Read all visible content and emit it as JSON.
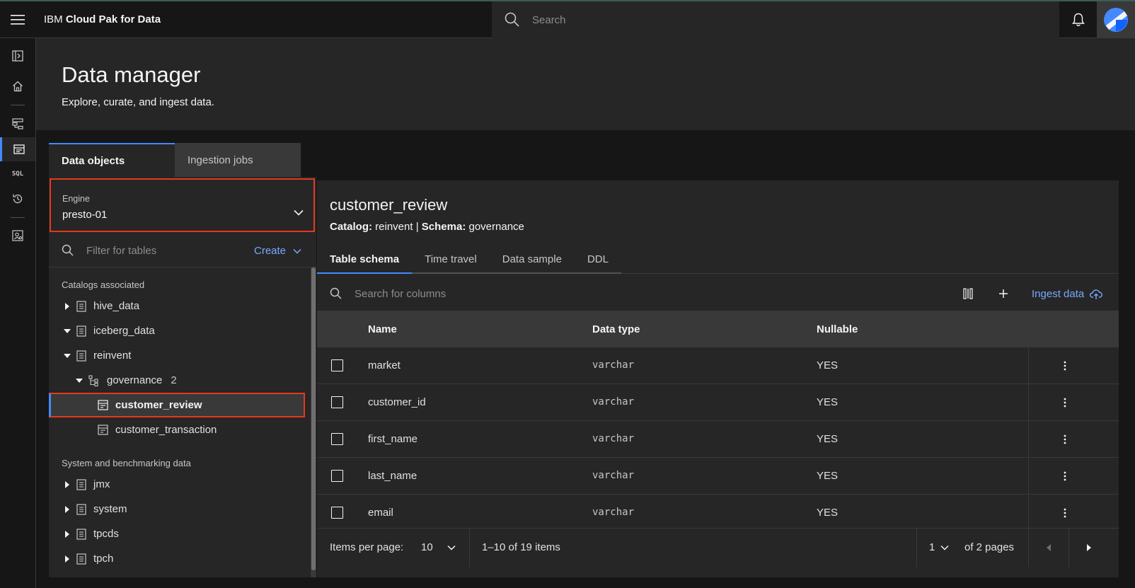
{
  "topbar": {
    "brand_prefix": "IBM",
    "brand_name": "Cloud Pak for Data",
    "search_placeholder": "Search"
  },
  "header": {
    "title": "Data manager",
    "subtitle": "Explore, curate, and ingest data."
  },
  "main_tabs": [
    {
      "label": "Data objects",
      "active": true
    },
    {
      "label": "Ingestion jobs",
      "active": false
    }
  ],
  "left_nav": {
    "sql_label": "SQL"
  },
  "engine": {
    "label": "Engine",
    "value": "presto-01"
  },
  "filter": {
    "placeholder": "Filter for tables",
    "create_label": "Create"
  },
  "tree": {
    "section1": "Catalogs associated",
    "catalogs": [
      {
        "name": "hive_data"
      },
      {
        "name": "iceberg_data"
      },
      {
        "name": "reinvent"
      }
    ],
    "schema": {
      "name": "governance",
      "count": "2"
    },
    "tables": [
      {
        "name": "customer_review"
      },
      {
        "name": "customer_transaction"
      }
    ],
    "section2": "System and benchmarking data",
    "system": [
      {
        "name": "jmx"
      },
      {
        "name": "system"
      },
      {
        "name": "tpcds"
      },
      {
        "name": "tpch"
      }
    ]
  },
  "detail": {
    "title": "customer_review",
    "catalog_label": "Catalog:",
    "catalog_value": "reinvent",
    "separator": "|",
    "schema_label": "Schema:",
    "schema_value": "governance",
    "tabs": [
      {
        "label": "Table schema",
        "active": true
      },
      {
        "label": "Time travel",
        "active": false
      },
      {
        "label": "Data sample",
        "active": false
      },
      {
        "label": "DDL",
        "active": false
      }
    ],
    "column_search_placeholder": "Search for columns",
    "ingest_label": "Ingest data",
    "columns": {
      "name": "Name",
      "type": "Data type",
      "nullable": "Nullable"
    },
    "rows": [
      {
        "name": "market",
        "type": "varchar",
        "nullable": "YES"
      },
      {
        "name": "customer_id",
        "type": "varchar",
        "nullable": "YES"
      },
      {
        "name": "first_name",
        "type": "varchar",
        "nullable": "YES"
      },
      {
        "name": "last_name",
        "type": "varchar",
        "nullable": "YES"
      },
      {
        "name": "email",
        "type": "varchar",
        "nullable": "YES"
      }
    ]
  },
  "pager": {
    "items_per_page_label": "Items per page:",
    "items_per_page": "10",
    "range": "1–10 of 19 items",
    "page": "1",
    "of_pages": "of 2 pages"
  },
  "colors": {
    "accent": "#4589ff",
    "link": "#78a9ff",
    "highlight": "#e5391c"
  }
}
